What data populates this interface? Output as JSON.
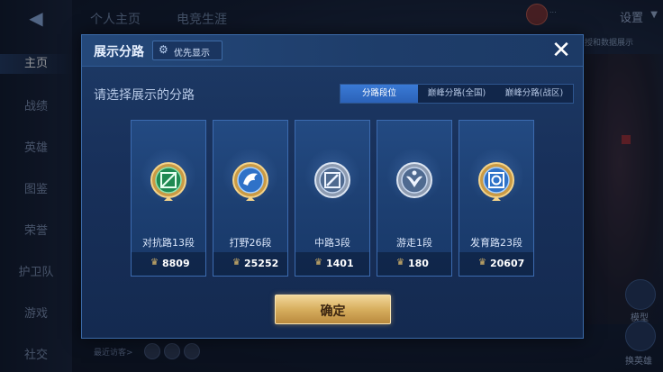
{
  "background": {
    "back_icon": "back-arrow-icon",
    "nav": [
      "主页",
      "战绩",
      "英雄",
      "图鉴",
      "荣誉",
      "护卫队",
      "游戏",
      "社交"
    ],
    "top_tabs": [
      "个人主页",
      "电竞生涯"
    ],
    "settings_label": "设置",
    "status_text": "...",
    "right_link": "授和数据展示",
    "side_buttons": [
      "模型",
      "换英雄"
    ],
    "visitors_label": "最近访客>"
  },
  "modal": {
    "title": "展示分路",
    "priority_label": "优先显示",
    "priority_icon": "gear-icon",
    "close_icon": "close-icon",
    "subtitle": "请选择展示的分路",
    "segments": [
      "分路段位",
      "巅峰分路(全国)",
      "巅峰分路(战区)"
    ],
    "active_segment": 0,
    "cards": [
      {
        "name": "对抗路13段",
        "score": "8809",
        "emblem": "clash-lane-emblem-icon"
      },
      {
        "name": "打野26段",
        "score": "25252",
        "emblem": "jungle-emblem-icon"
      },
      {
        "name": "中路3段",
        "score": "1401",
        "emblem": "mid-lane-emblem-icon"
      },
      {
        "name": "游走1段",
        "score": "180",
        "emblem": "roam-emblem-icon"
      },
      {
        "name": "发育路23段",
        "score": "20607",
        "emblem": "farm-lane-emblem-icon"
      }
    ],
    "confirm_label": "确定"
  },
  "colors": {
    "gold": "#d7ae5e",
    "emblem_green": "#2fb56a",
    "emblem_blue": "#3b8de0",
    "emblem_silver": "#9aa8bc"
  }
}
